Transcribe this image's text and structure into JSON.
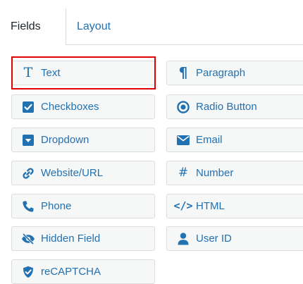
{
  "tabs": {
    "fields_label": "Fields",
    "layout_label": "Layout"
  },
  "fields": {
    "text": "Text",
    "paragraph": "Paragraph",
    "checkboxes": "Checkboxes",
    "radio_button": "Radio Button",
    "dropdown": "Dropdown",
    "email": "Email",
    "website_url": "Website/URL",
    "number": "Number",
    "phone": "Phone",
    "html": "HTML",
    "hidden_field": "Hidden Field",
    "user_id": "User ID",
    "recaptcha": "reCAPTCHA"
  },
  "icons": {
    "text": "T",
    "paragraph": "¶",
    "number": "#",
    "html": "</>"
  },
  "colors": {
    "accent": "#2271b1",
    "button_bg": "#f6f7f7",
    "border": "#dcdcde",
    "selection_outline": "#e00000"
  }
}
